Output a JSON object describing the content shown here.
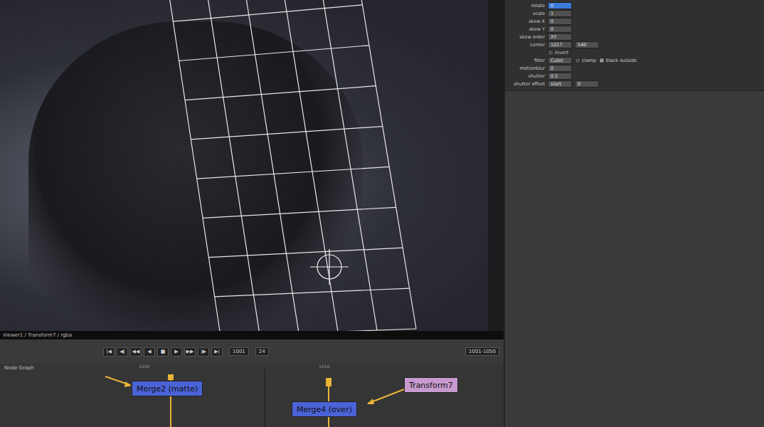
{
  "viewer": {
    "label": "Viewer1 / Transform7 / rgba"
  },
  "transport": {
    "buttons": [
      "|◀",
      "◀|",
      "◀◀",
      "◀",
      "■",
      "▶",
      "▶▶",
      "|▶",
      "▶|"
    ],
    "frame": "1001",
    "fps": "24",
    "range": "1001-1050"
  },
  "properties": [
    {
      "label": "rotate",
      "kind": "field",
      "values": [
        "0"
      ],
      "highlighted": true
    },
    {
      "label": "scale",
      "kind": "field",
      "values": [
        "1"
      ],
      "highlighted": false
    },
    {
      "label": "skew X",
      "kind": "field",
      "values": [
        "0"
      ],
      "highlighted": false
    },
    {
      "label": "skew Y",
      "kind": "field",
      "values": [
        "0"
      ],
      "highlighted": false
    },
    {
      "label": "skew order",
      "kind": "field",
      "values": [
        "XY"
      ],
      "highlighted": false
    },
    {
      "label": "center",
      "kind": "field",
      "values": [
        "1017",
        "540"
      ],
      "highlighted": false
    },
    {
      "label": "",
      "kind": "checks",
      "checks": [
        {
          "label": "invert",
          "checked": false
        }
      ]
    },
    {
      "label": "filter",
      "kind": "mixed",
      "values": [
        "Cubic"
      ],
      "checks": [
        {
          "label": "clamp",
          "checked": false
        },
        {
          "label": "black outside",
          "checked": true
        }
      ]
    },
    {
      "label": "motionblur",
      "kind": "field",
      "values": [
        "0"
      ],
      "highlighted": false
    },
    {
      "label": "shutter",
      "kind": "field",
      "values": [
        "0.5"
      ],
      "highlighted": false
    },
    {
      "label": "shutter offset",
      "kind": "field",
      "values": [
        "start",
        "0"
      ],
      "highlighted": false
    }
  ],
  "node_graph": {
    "title": "Node Graph",
    "ruler": [
      "1000",
      "1010"
    ],
    "nodes": [
      {
        "label": "Merge2 (matte)",
        "color": "#4a63d6"
      },
      {
        "label": "Merge4 (over)",
        "color": "#4a63d6"
      },
      {
        "label": "Transform7",
        "color": "#c79bcf"
      }
    ]
  }
}
